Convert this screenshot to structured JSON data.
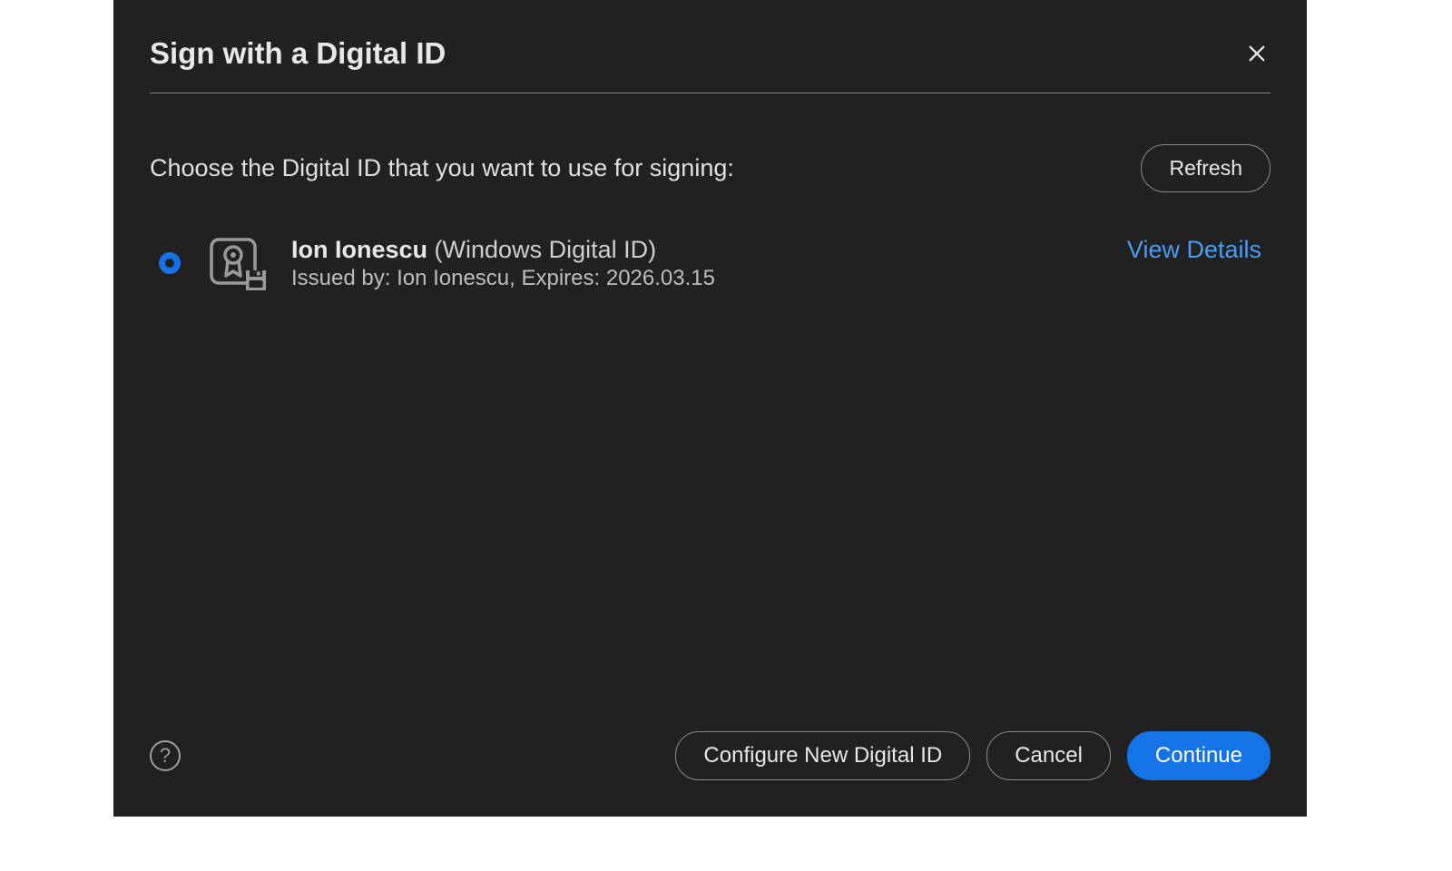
{
  "dialog": {
    "title": "Sign with a Digital ID",
    "instruction": "Choose the Digital ID that you want to use for signing:",
    "refresh_label": "Refresh",
    "ids": [
      {
        "name": "Ion Ionescu",
        "type": "(Windows Digital ID)",
        "details": "Issued by: Ion Ionescu, Expires: 2026.03.15",
        "selected": true
      }
    ],
    "view_details_label": "View Details",
    "footer": {
      "help_symbol": "?",
      "configure_label": "Configure New Digital ID",
      "cancel_label": "Cancel",
      "continue_label": "Continue"
    }
  }
}
